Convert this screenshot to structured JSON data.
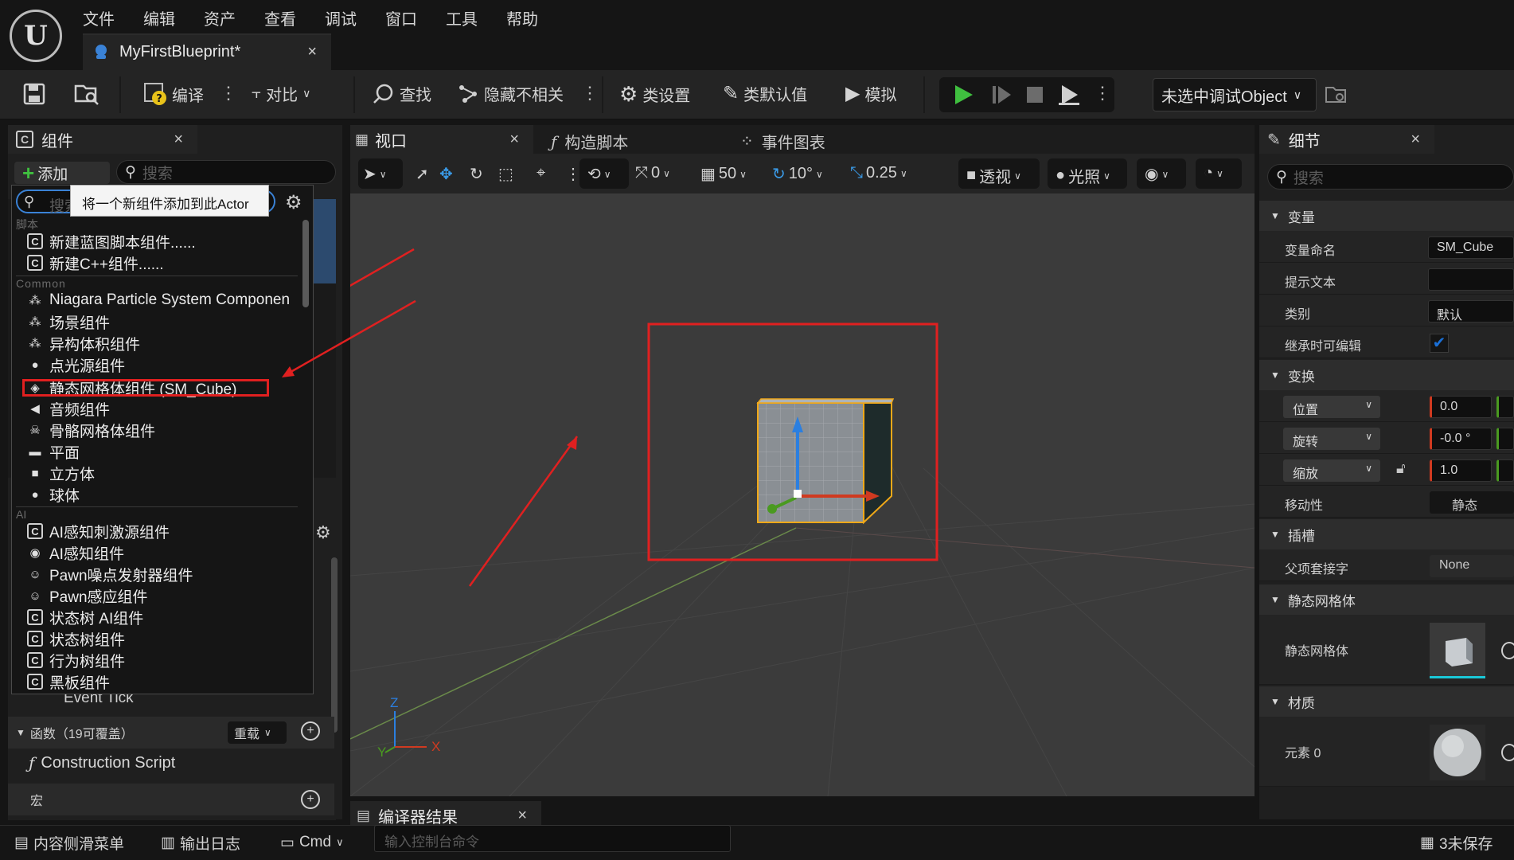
{
  "menu": [
    "文件",
    "编辑",
    "资产",
    "查看",
    "调试",
    "窗口",
    "工具",
    "帮助"
  ],
  "doc_tab": {
    "label": "MyFirstBlueprint*",
    "close": "×"
  },
  "toolbar": {
    "compile": "编译",
    "diff": "对比",
    "find": "查找",
    "hide_unrelated": "隐藏不相关",
    "class_settings": "类设置",
    "class_defaults": "类默认值",
    "simulate": "模拟",
    "debug_object": "未选中调试Object"
  },
  "components_panel": {
    "tab": "组件",
    "close": "×",
    "add_label": "添加",
    "search_placeholder": "搜索",
    "dropdown_search_placeholder": "搜索",
    "tooltip": "将一个新组件添加到此Actor"
  },
  "dropdown": {
    "cat_script": "脚本",
    "script_items": [
      "新建蓝图脚本组件......",
      "新建C++组件......"
    ],
    "cat_common": "Common",
    "common_items": [
      {
        "label": "Niagara Particle System Componen",
        "icon": "particle-icon"
      },
      {
        "label": "场景组件",
        "icon": "scene-icon"
      },
      {
        "label": "异构体积组件",
        "icon": "volume-icon"
      },
      {
        "label": "点光源组件",
        "icon": "bulb-icon"
      },
      {
        "label": "静态网格体组件 (SM_Cube)",
        "icon": "mesh-icon"
      },
      {
        "label": "音频组件",
        "icon": "speaker-icon"
      },
      {
        "label": "骨骼网格体组件",
        "icon": "skeleton-icon"
      },
      {
        "label": "平面",
        "icon": "plane-icon"
      },
      {
        "label": "立方体",
        "icon": "cube-icon"
      },
      {
        "label": "球体",
        "icon": "sphere-icon"
      }
    ],
    "cat_ai": "AI",
    "ai_items": [
      {
        "label": "AI感知刺激源组件",
        "icon": "c-icon"
      },
      {
        "label": "AI感知组件",
        "icon": "perception-icon"
      },
      {
        "label": "Pawn噪点发射器组件",
        "icon": "noise-icon"
      },
      {
        "label": "Pawn感应组件",
        "icon": "sensing-icon"
      },
      {
        "label": "状态树 AI组件",
        "icon": "c-icon"
      },
      {
        "label": "状态树组件",
        "icon": "c-icon"
      },
      {
        "label": "行为树组件",
        "icon": "c-icon"
      },
      {
        "label": "黑板组件",
        "icon": "c-icon"
      }
    ]
  },
  "left_lower": {
    "event_tick": "Event Tick",
    "functions": "函数（19可覆盖）",
    "override": "重载",
    "construction_script": "Construction Script",
    "macros": "宏"
  },
  "viewport_tabs": {
    "viewport": "视口",
    "construction": "构造脚本",
    "event_graph": "事件图表",
    "compiler_results": "编译器结果"
  },
  "viewport_toolbar": {
    "rot_snap": "0",
    "grid": "50",
    "angle": "10°",
    "scale": "0.25",
    "perspective": "透视",
    "lighting": "光照"
  },
  "axis": {
    "z": "Z",
    "x": "X",
    "y": "Y"
  },
  "details": {
    "tab": "细节",
    "close": "×",
    "search_placeholder": "搜索",
    "sec_variable": "变量",
    "var_name_label": "变量命名",
    "var_name_value": "SM_Cube",
    "tooltip_label": "提示文本",
    "category_label": "类别",
    "category_value": "默认",
    "editable_label": "继承时可编辑",
    "sec_transform": "变换",
    "location": "位置",
    "location_x": "0.0",
    "rotation": "旋转",
    "rotation_x": "-0.0 °",
    "scale": "缩放",
    "scale_x": "1.0",
    "mobility_label": "移动性",
    "mobility_value": "静态",
    "sec_sockets": "插槽",
    "parent_socket_label": "父项套接字",
    "parent_socket_value": "None",
    "sec_static_mesh": "静态网格体",
    "static_mesh_label": "静态网格体",
    "sec_material": "材质",
    "element0_label": "元素 0"
  },
  "statusbar": {
    "content_drawer": "内容侧滑菜单",
    "output_log": "输出日志",
    "cmd": "Cmd",
    "console_placeholder": "输入控制台命令",
    "unsaved": "3未保存"
  },
  "colors": {
    "accent_red": "#e02020",
    "play_green": "#3fbf3f",
    "check_blue": "#1a6fd6"
  }
}
